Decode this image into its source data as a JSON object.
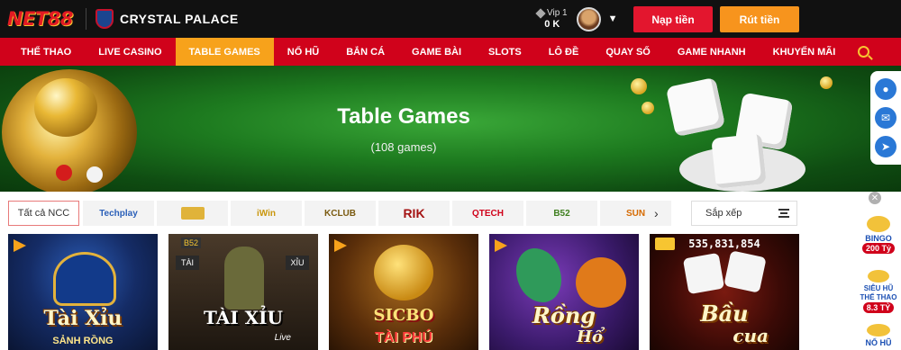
{
  "header": {
    "logo_text": "NET88",
    "partner_name": "CRYSTAL PALACE",
    "vip_level": "Vip 1",
    "balance": "0 K",
    "deposit_label": "Nạp tiền",
    "withdraw_label": "Rút tiền"
  },
  "nav": {
    "items": [
      {
        "label": "THỂ THAO"
      },
      {
        "label": "LIVE CASINO"
      },
      {
        "label": "TABLE GAMES"
      },
      {
        "label": "NỔ HŨ"
      },
      {
        "label": "BẮN CÁ"
      },
      {
        "label": "GAME BÀI"
      },
      {
        "label": "SLOTS"
      },
      {
        "label": "LÔ ĐỀ"
      },
      {
        "label": "QUAY SỐ"
      },
      {
        "label": "GAME NHANH"
      },
      {
        "label": "KHUYẾN MÃI"
      }
    ],
    "active_index": 2
  },
  "banner": {
    "title": "Table Games",
    "count": "(108 games)"
  },
  "providers": {
    "all_label": "Tất cả NCC",
    "items": [
      "Techplay",
      "",
      "iWin",
      "KCLUB",
      "RIK",
      "QTECH",
      "B52",
      "SUN"
    ],
    "sort_label": "Sắp xếp"
  },
  "games": [
    {
      "title": "Tài Xỉu",
      "subtitle": "SẢNH RỒNG"
    },
    {
      "title": "TÀI XỈU",
      "subtitle": "Live",
      "tags": [
        "TÀI",
        "XỈU",
        "B52"
      ]
    },
    {
      "title": "SICBO",
      "subtitle": "TÀI PHÚ"
    },
    {
      "title": "Rồng",
      "subtitle": "Hổ"
    },
    {
      "title": "Bầu",
      "subtitle": "cua",
      "jackpot": "535,831,854"
    }
  ],
  "promos": [
    {
      "top": "BINGO",
      "value": "200 Tỷ"
    },
    {
      "top": "SIÊU HŨ THỂ THAO",
      "value": "8.3 TỶ"
    },
    {
      "top": "NỔ HŨ",
      "value": ""
    }
  ]
}
